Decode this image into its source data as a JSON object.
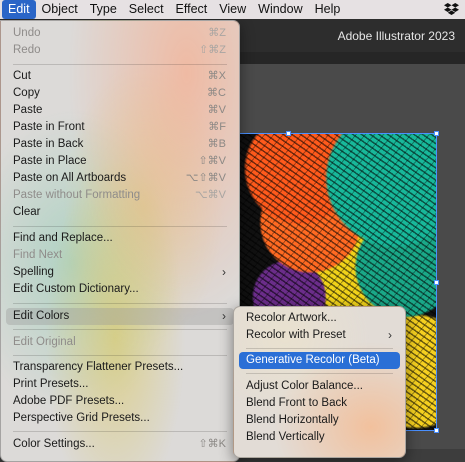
{
  "menubar": {
    "items": [
      "Edit",
      "Object",
      "Type",
      "Select",
      "Effect",
      "View",
      "Window",
      "Help"
    ],
    "dropbox_icon": "dropbox-icon"
  },
  "app": {
    "title": "Adobe Illustrator 2023"
  },
  "edit_menu": {
    "undo": {
      "label": "Undo",
      "shortcut": "⌘Z"
    },
    "redo": {
      "label": "Redo",
      "shortcut": "⇧⌘Z"
    },
    "cut": {
      "label": "Cut",
      "shortcut": "⌘X"
    },
    "copy": {
      "label": "Copy",
      "shortcut": "⌘C"
    },
    "paste": {
      "label": "Paste",
      "shortcut": "⌘V"
    },
    "paste_front": {
      "label": "Paste in Front",
      "shortcut": "⌘F"
    },
    "paste_back": {
      "label": "Paste in Back",
      "shortcut": "⌘B"
    },
    "paste_place": {
      "label": "Paste in Place",
      "shortcut": "⇧⌘V"
    },
    "paste_all": {
      "label": "Paste on All Artboards",
      "shortcut": "⌥⇧⌘V"
    },
    "paste_noformat": {
      "label": "Paste without Formatting",
      "shortcut": "⌥⌘V"
    },
    "clear": {
      "label": "Clear"
    },
    "find_replace": {
      "label": "Find and Replace..."
    },
    "find_next": {
      "label": "Find Next"
    },
    "spelling": {
      "label": "Spelling"
    },
    "custom_dict": {
      "label": "Edit Custom Dictionary..."
    },
    "edit_colors": {
      "label": "Edit Colors"
    },
    "edit_original": {
      "label": "Edit Original"
    },
    "transparency": {
      "label": "Transparency Flattener Presets..."
    },
    "print_presets": {
      "label": "Print Presets..."
    },
    "pdf_presets": {
      "label": "Adobe PDF Presets..."
    },
    "grid_presets": {
      "label": "Perspective Grid Presets..."
    },
    "color_settings": {
      "label": "Color Settings...",
      "shortcut": "⇧⌘K"
    }
  },
  "colors_submenu": {
    "recolor_artwork": "Recolor Artwork...",
    "recolor_preset": "Recolor with Preset",
    "generative_recolor": "Generative Recolor (Beta)",
    "adjust_balance": "Adjust Color Balance...",
    "blend_front_back": "Blend Front to Back",
    "blend_horizontal": "Blend Horizontally",
    "blend_vertical": "Blend Vertically"
  },
  "colors": {
    "highlight": "#2a6fd6",
    "menubar_active": "#2a65c7",
    "selection": "#4a90ff"
  }
}
